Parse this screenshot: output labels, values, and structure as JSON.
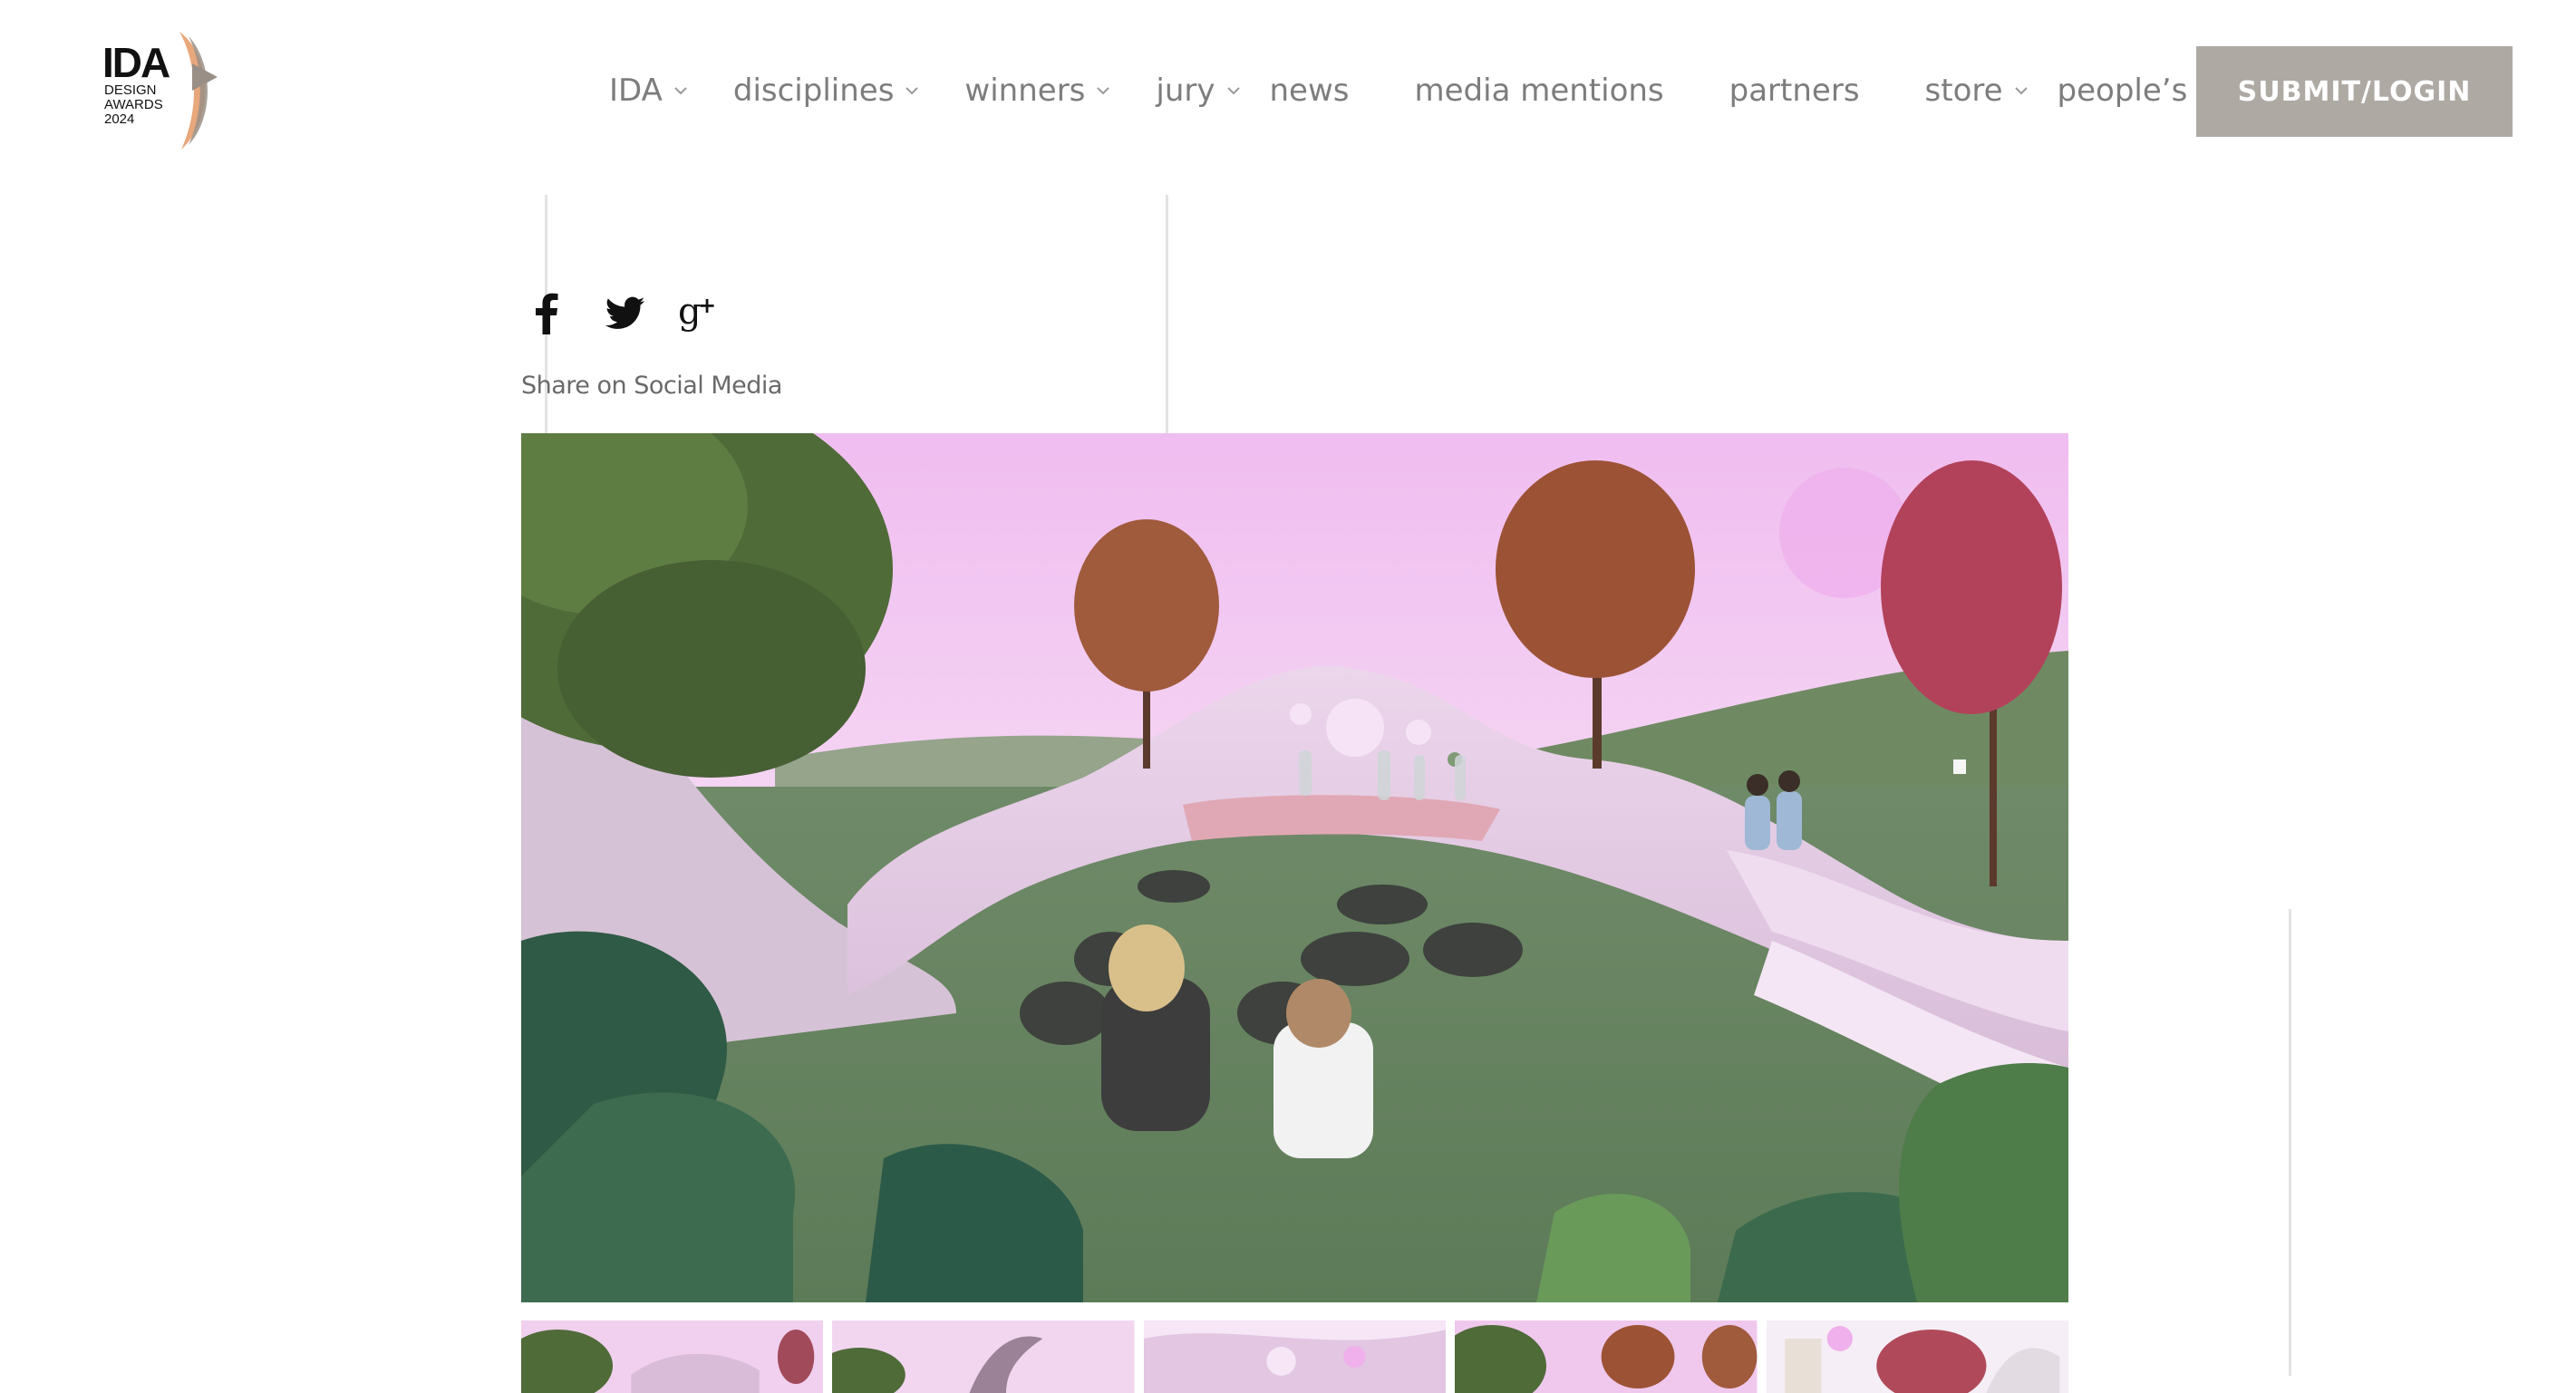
{
  "logo": {
    "line1": "IDA",
    "line2": "DESIGN",
    "line3": "AWARDS",
    "line4": "2024",
    "accent_colors": [
      "#e8a87c",
      "#9a8f86"
    ]
  },
  "nav": {
    "items": [
      {
        "label": "IDA",
        "has_dropdown": true
      },
      {
        "label": "disciplines",
        "has_dropdown": true
      },
      {
        "label": "winners",
        "has_dropdown": true
      },
      {
        "label": "jury",
        "has_dropdown": true
      },
      {
        "label": "news",
        "has_dropdown": false
      },
      {
        "label": "media mentions",
        "has_dropdown": false
      },
      {
        "label": "partners",
        "has_dropdown": false
      },
      {
        "label": "store",
        "has_dropdown": true
      },
      {
        "label": "people’s choice",
        "has_dropdown": true
      }
    ],
    "submit_label": "SUBMIT/LOGIN",
    "submit_color": "#aea9a3",
    "text_color": "#7d7d7d"
  },
  "share": {
    "label": "Share on Social Media",
    "icons": [
      "facebook-icon",
      "twitter-icon",
      "google-plus-icon"
    ]
  },
  "gallery": {
    "main_image": "landscape-amphitheater-render",
    "thumbnail_count": 5,
    "sky_color": "#f3c8f0",
    "grass_color": "#6e8a66",
    "structure_color": "#e6cde6"
  }
}
